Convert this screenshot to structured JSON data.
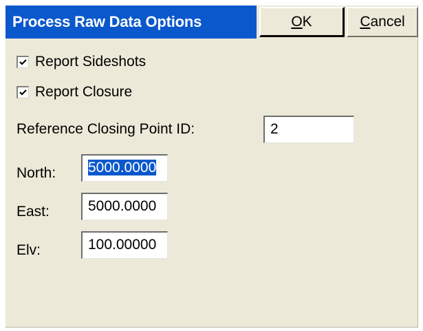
{
  "dialog": {
    "title": "Process Raw Data Options",
    "ok_label_accel": "O",
    "ok_label_rest": "K",
    "cancel_label_accel": "C",
    "cancel_label_rest": "ancel"
  },
  "options": {
    "report_sideshots": {
      "label": "Report Sideshots",
      "checked": true
    },
    "report_closure": {
      "label": "Report Closure",
      "checked": true
    }
  },
  "reference": {
    "label": "Reference Closing Point ID:",
    "value": "2"
  },
  "coords": {
    "north_label": "North:",
    "north_value": "5000.0000",
    "east_label": "East:",
    "east_value": "5000.0000",
    "elv_label": "Elv:",
    "elv_value": "100.00000"
  },
  "colors": {
    "title_bg": "#0a58cc",
    "dialog_bg": "#ece9d8",
    "selection": "#0a58cc"
  }
}
